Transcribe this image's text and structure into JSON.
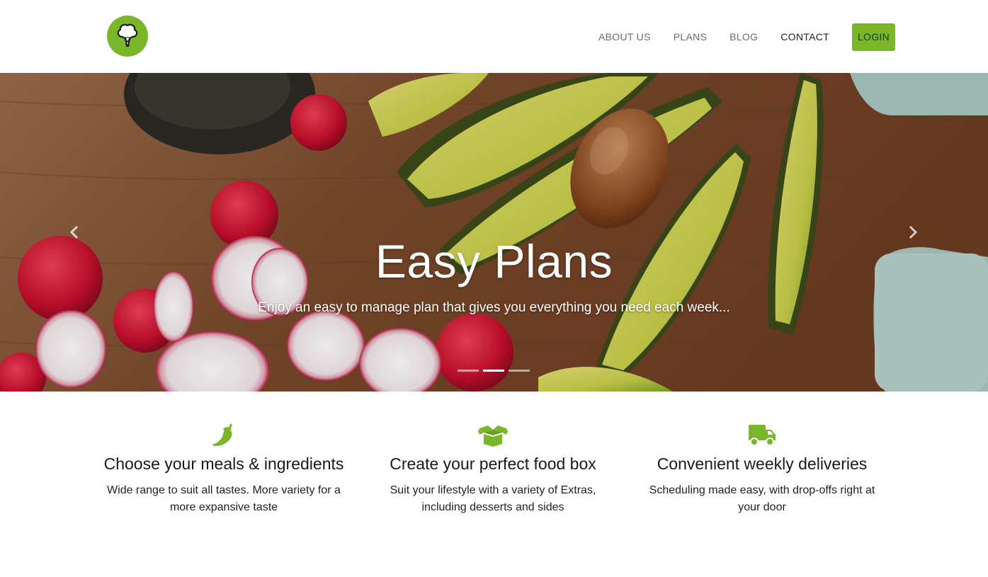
{
  "brand": {
    "logo_icon": "broccoli-tree-icon",
    "color": "#7ab62a"
  },
  "nav": {
    "items": [
      {
        "label": "ABOUT US"
      },
      {
        "label": "PLANS"
      },
      {
        "label": "BLOG"
      },
      {
        "label": "CONTACT",
        "active": true
      }
    ],
    "login_label": "LOGIN"
  },
  "hero": {
    "title": "Easy Plans",
    "subtitle": "Enjoy an easy to manage plan that gives you everything you need each week...",
    "prev_icon": "chevron-left-icon",
    "next_icon": "chevron-right-icon",
    "slide_count": 3,
    "active_slide": 2
  },
  "features": [
    {
      "icon": "chili-pepper-icon",
      "title": "Choose your meals & ingredients",
      "text": "Wide range to suit all tastes. More variety for a more expansive taste"
    },
    {
      "icon": "open-box-icon",
      "title": "Create your perfect food box",
      "text": "Suit your lifestyle with a variety of Extras, including desserts and sides"
    },
    {
      "icon": "delivery-truck-icon",
      "title": "Convenient weekly deliveries",
      "text": "Scheduling made easy, with drop-offs right at your door"
    }
  ],
  "colors": {
    "accent": "#7ab62a",
    "login_text": "#1d3a06"
  }
}
